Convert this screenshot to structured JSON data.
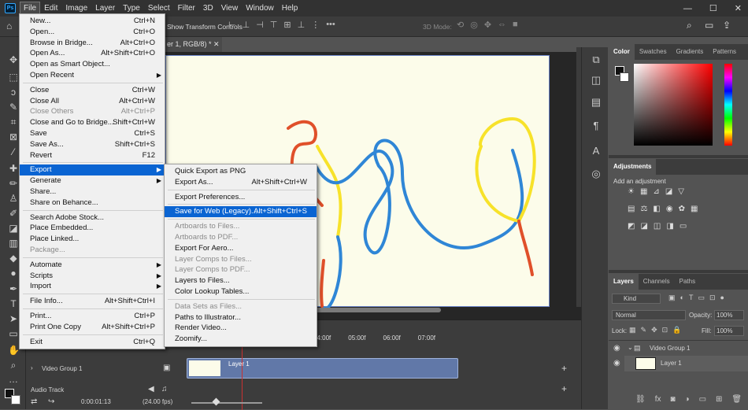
{
  "menubar": {
    "items": [
      "File",
      "Edit",
      "Image",
      "Layer",
      "Type",
      "Select",
      "Filter",
      "3D",
      "View",
      "Window",
      "Help"
    ],
    "window_controls": [
      "—",
      "☐",
      "✕"
    ]
  },
  "optionsbar": {
    "show_transform": "Show Transform Controls",
    "mode3d": "3D Mode:"
  },
  "document": {
    "tab_title": "er 1, RGB/8) *"
  },
  "file_menu": [
    {
      "label": "New...",
      "shortcut": "Ctrl+N"
    },
    {
      "label": "Open...",
      "shortcut": "Ctrl+O"
    },
    {
      "label": "Browse in Bridge...",
      "shortcut": "Alt+Ctrl+O"
    },
    {
      "label": "Open As...",
      "shortcut": "Alt+Shift+Ctrl+O"
    },
    {
      "label": "Open as Smart Object...",
      "shortcut": ""
    },
    {
      "label": "Open Recent",
      "shortcut": "",
      "submenu": true
    },
    {
      "sep": true
    },
    {
      "label": "Close",
      "shortcut": "Ctrl+W"
    },
    {
      "label": "Close All",
      "shortcut": "Alt+Ctrl+W"
    },
    {
      "label": "Close Others",
      "shortcut": "Alt+Ctrl+P",
      "disabled": true
    },
    {
      "label": "Close and Go to Bridge...",
      "shortcut": "Shift+Ctrl+W"
    },
    {
      "label": "Save",
      "shortcut": "Ctrl+S"
    },
    {
      "label": "Save As...",
      "shortcut": "Shift+Ctrl+S"
    },
    {
      "label": "Revert",
      "shortcut": "F12"
    },
    {
      "sep": true
    },
    {
      "label": "Export",
      "shortcut": "",
      "submenu": true,
      "selected": true
    },
    {
      "label": "Generate",
      "shortcut": "",
      "submenu": true
    },
    {
      "label": "Share...",
      "shortcut": ""
    },
    {
      "label": "Share on Behance...",
      "shortcut": ""
    },
    {
      "sep": true
    },
    {
      "label": "Search Adobe Stock...",
      "shortcut": ""
    },
    {
      "label": "Place Embedded...",
      "shortcut": ""
    },
    {
      "label": "Place Linked...",
      "shortcut": ""
    },
    {
      "label": "Package...",
      "shortcut": "",
      "disabled": true
    },
    {
      "sep": true
    },
    {
      "label": "Automate",
      "shortcut": "",
      "submenu": true
    },
    {
      "label": "Scripts",
      "shortcut": "",
      "submenu": true
    },
    {
      "label": "Import",
      "shortcut": "",
      "submenu": true
    },
    {
      "sep": true
    },
    {
      "label": "File Info...",
      "shortcut": "Alt+Shift+Ctrl+I"
    },
    {
      "sep": true
    },
    {
      "label": "Print...",
      "shortcut": "Ctrl+P"
    },
    {
      "label": "Print One Copy",
      "shortcut": "Alt+Shift+Ctrl+P"
    },
    {
      "sep": true
    },
    {
      "label": "Exit",
      "shortcut": "Ctrl+Q"
    }
  ],
  "export_menu": [
    {
      "label": "Quick Export as PNG",
      "shortcut": ""
    },
    {
      "label": "Export As...",
      "shortcut": "Alt+Shift+Ctrl+W"
    },
    {
      "sep": true
    },
    {
      "label": "Export Preferences...",
      "shortcut": ""
    },
    {
      "sep": true
    },
    {
      "label": "Save for Web (Legacy)...",
      "shortcut": "Alt+Shift+Ctrl+S",
      "selected": true
    },
    {
      "sep": true
    },
    {
      "label": "Artboards to Files...",
      "shortcut": "",
      "disabled": true
    },
    {
      "label": "Artboards to PDF...",
      "shortcut": "",
      "disabled": true
    },
    {
      "label": "Export For Aero...",
      "shortcut": ""
    },
    {
      "label": "Layer Comps to Files...",
      "shortcut": "",
      "disabled": true
    },
    {
      "label": "Layer Comps to PDF...",
      "shortcut": "",
      "disabled": true
    },
    {
      "label": "Layers to Files...",
      "shortcut": ""
    },
    {
      "label": "Color Lookup Tables...",
      "shortcut": ""
    },
    {
      "sep": true
    },
    {
      "label": "Data Sets as Files...",
      "shortcut": "",
      "disabled": true
    },
    {
      "label": "Paths to Illustrator...",
      "shortcut": ""
    },
    {
      "label": "Render Video...",
      "shortcut": ""
    },
    {
      "label": "Zoomify...",
      "shortcut": ""
    }
  ],
  "color_panel": {
    "tabs": [
      "Color",
      "Swatches",
      "Gradients",
      "Patterns"
    ]
  },
  "adjustments_panel": {
    "title": "Adjustments",
    "subtitle": "Add an adjustment"
  },
  "layers_panel": {
    "tabs": [
      "Layers",
      "Channels",
      "Paths"
    ],
    "filter": "Kind",
    "blend_mode": "Normal",
    "opacity_label": "Opacity:",
    "opacity": "100%",
    "lock_label": "Lock:",
    "fill_label": "Fill:",
    "fill": "100%",
    "layers": [
      {
        "name": "Video Group 1"
      },
      {
        "name": "Layer 1"
      }
    ]
  },
  "timeline": {
    "ticks": [
      "04:00f",
      "05:00f",
      "06:00f",
      "07:00f"
    ],
    "video_group": "Video Group 1",
    "clip": "Layer 1",
    "audio_track": "Audio Track",
    "timecode": "0:00:01:13",
    "fps": "(24.00 fps)"
  },
  "colors": {
    "accent": "#0a64d2",
    "stroke_blue": "#2f86d6",
    "stroke_red": "#e0502a",
    "stroke_yellow": "#f7e22a"
  }
}
